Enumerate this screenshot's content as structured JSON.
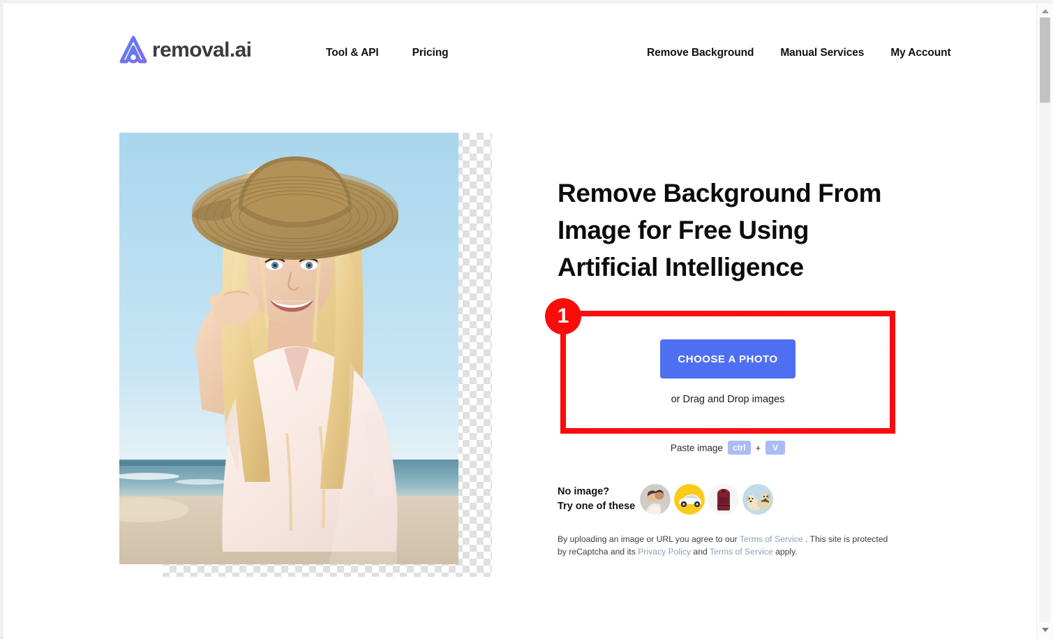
{
  "brand": {
    "logo_icon": "removal-ai-logo-icon",
    "word": "removal.ai"
  },
  "nav": {
    "left": [
      {
        "label": "Tool & API"
      },
      {
        "label": "Pricing"
      }
    ],
    "right": [
      {
        "label": "Remove Background"
      },
      {
        "label": "Manual Services"
      },
      {
        "label": "My Account"
      }
    ]
  },
  "showcase": {
    "alt": "Before and after background removal preview: smiling blonde woman in a straw hat at the beach, background replaced by transparency checkerboard"
  },
  "hero": {
    "title": "Remove Background From Image for Free Using Artificial Intelligence"
  },
  "annotation": {
    "badge_number": "1",
    "box_color": "#fc0b0b"
  },
  "upload": {
    "button_label": "CHOOSE A PHOTO",
    "drag_text": "or Drag and Drop images",
    "button_color": "#4f6ff2"
  },
  "paste": {
    "label": "Paste image",
    "key_one": "ctrl",
    "separator": "+",
    "key_two": "V"
  },
  "samples": {
    "label_line1": "No image?",
    "label_line2": "Try one of these",
    "thumbs": [
      {
        "name": "sample-couple",
        "icon": "couple-photo-icon",
        "bg": "#cdcbc9"
      },
      {
        "name": "sample-car",
        "icon": "car-photo-icon",
        "bg": "#fbcb1b"
      },
      {
        "name": "sample-backpack",
        "icon": "backpack-photo-icon",
        "bg": "#f4f4f4"
      },
      {
        "name": "sample-dogs",
        "icon": "dogs-photo-icon",
        "bg": "#bfdce8"
      }
    ]
  },
  "legal": {
    "part1": "By uploading an image or URL you agree to our ",
    "link_terms_1": "Terms of Service",
    "part2": " . This site is protected by reCaptcha and its ",
    "link_privacy": "Privacy Policy",
    "part3": " and ",
    "link_terms_2": "Terms of Service",
    "part4": " apply."
  },
  "scrollbar": {
    "up_icon": "chevron-up-icon",
    "down_icon": "chevron-down-icon"
  }
}
